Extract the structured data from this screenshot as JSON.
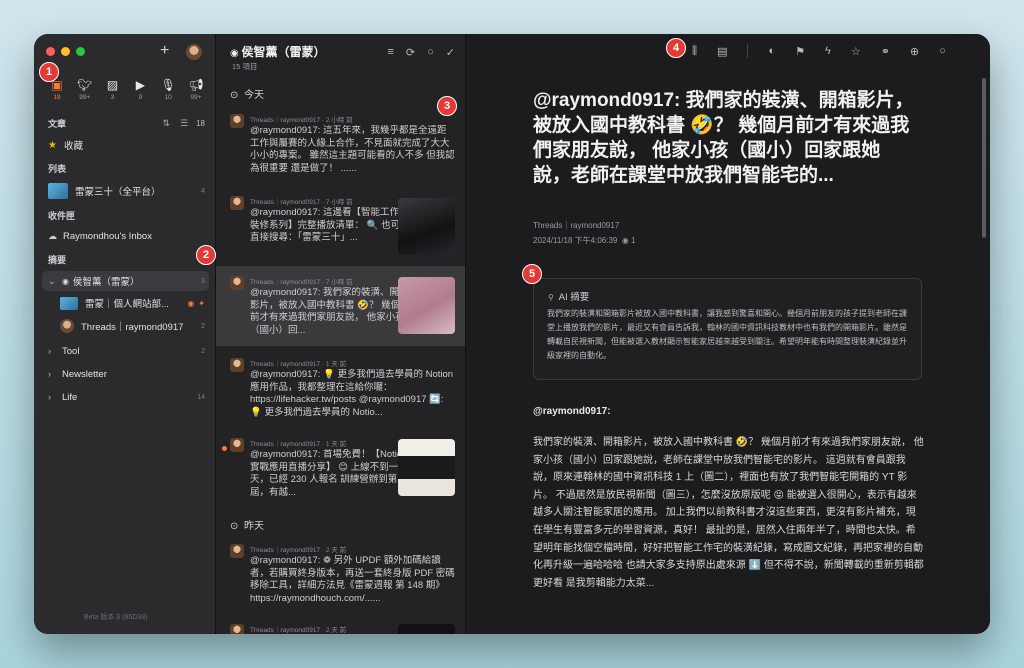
{
  "sidebar": {
    "sources": [
      {
        "icon": "folder-icon",
        "count": "19"
      },
      {
        "icon": "twitter-icon",
        "count": "99+"
      },
      {
        "icon": "image-icon",
        "count": "3"
      },
      {
        "icon": "youtube-icon",
        "count": "9"
      },
      {
        "icon": "podcast-icon",
        "count": "10"
      },
      {
        "icon": "megaphone-icon",
        "count": "99+"
      }
    ],
    "articles_label": "文章",
    "articles_count": "18",
    "starred": "收藏",
    "lists_label": "列表",
    "list_item": "雷蒙三十（全平台）",
    "list_item_count": "4",
    "inbox_label": "收件匣",
    "inbox_item": "Raymondhou's Inbox",
    "digest_label": "摘要",
    "groups": [
      {
        "label": "侯智薰（雷蒙）",
        "count": "3"
      },
      {
        "label": "雷蒙｜個人網站部...",
        "count": ""
      },
      {
        "label": "Threads｜raymond0917",
        "count": "2"
      },
      {
        "label": "Tool",
        "count": "2"
      },
      {
        "label": "Newsletter",
        "count": ""
      },
      {
        "label": "Life",
        "count": "14"
      }
    ],
    "footer": "Beta 版本 β (85D38)"
  },
  "list": {
    "title": "侯智薰（雷蒙）",
    "subtitle": "15 項目",
    "today": "今天",
    "yesterday": "昨天",
    "entries": [
      {
        "meta": "Threads｜raymond0917 · 2 小時 前",
        "text": "@raymond0917: 這五年來，我幾乎都是全遠距工作與屬賽的人緣上合作，不見面就完成了大大小小的專案。 雖然這主題可能看的人不多 但我認為很重要 還是做了！ ......"
      },
      {
        "meta": "Threads｜raymond0917 · 7 小時 前",
        "text": "@raymond0917: 這邊看【智能工作宅裝修系列】完整播放清單： 🔍 也可以直接搜尋：「雷蒙三十」..."
      },
      {
        "meta": "Threads｜raymond0917 · 7 小時 前",
        "text": "@raymond0917: 我們家的裝潢、開箱影片，被放入國中教科書 🤣？ 幾個月前才有來過我們家朋友說， 他家小孩（國小）回..."
      },
      {
        "meta": "Threads｜raymond0917 · 1 天 前",
        "text": "@raymond0917: 💡 更多我們過去學員的 Notion 應用作品，我都整理在這給你囉：https://lifehacker.tw/posts @raymond0917 🔄: 💡 更多我們過去學員的 Notio..."
      },
      {
        "meta": "Threads｜raymond0917 · 1 天 前",
        "text": "@raymond0917: 首場免費！【Notion 實戰應用直播分享】 😊 上線不到一天，已經 230 人報名 訓練營辦到第九屆，有越..."
      },
      {
        "meta": "Threads｜raymond0917 · 2 天 前",
        "text": "@raymond0917: ❁ 另外 UPDF 額外加碼給讀者，若購買終身版本，再送一套終身版 PDF 密碼移除工具，詳細方法見《雷蒙週報 第 148 期》 https://raymondhouch.com/......"
      },
      {
        "meta": "Threads｜raymond0917 · 2 天 前",
        "text": ""
      }
    ]
  },
  "reader": {
    "title": "@raymond0917: 我們家的裝潢、開箱影片，被放入國中教科書 🤣？ 幾個月前才有來過我們家朋友說， 他家小孩（國小）回家跟她說，老師在課堂中放我們智能宅的...",
    "source": "Threads｜raymond0917",
    "date": "2024/11/18 下午4:06:39",
    "views": "1",
    "ai_label": "AI 摘要",
    "ai_text": "我們家的裝潢和開箱影片被放入國中教科書，讓我感到驚喜和開心。幾個月前朋友的孩子提到老師在課堂上播放我們的影片，最近又有會員告訴我，翰林的國中資訊科技教材中也有我們的開箱影片。雖然是轉載自民視新聞，但能被選入教材顯示智能家居越來越受到關注。希望明年能有時間整理裝潢紀錄並升級家裡的自動化。",
    "author": "@raymond0917:",
    "body": "我們家的裝潢、開箱影片，被放入國中教科書 🤣？ 幾個月前才有來過我們家朋友說， 他家小孩（國小）回家跟她說，老師在課堂中放我們智能宅的影片。 這週就有會員跟我說，原來連翰林的國中資訊科技 1 上（圖二），裡面也有放了我們智能宅開箱的 YT 影片。 不過居然是放民視新聞（圖三），怎麼沒放原版呢 😝 能被選入很開心，表示有越來越多人關注智能家居的應用。 加上我們以前教科書才沒這些東西，更沒有影片補充，現在學生有豐富多元的學習資源，真好！ 最扯的是，居然入住兩年半了，時間也太快。希望明年能找個空檔時間，好好把智能工作宅的裝潢紀錄，寫成圖文紀錄，再把家裡的自動化再升級一遍哈哈哈 也請大家多支持原出處來源 ⬇️ 但不得不說，新聞轉載的重新剪輯都更好看 是我剪輯能力太菜..."
  },
  "markers": [
    "1",
    "2",
    "3",
    "4",
    "5"
  ],
  "colors": {
    "accent": "#ff7b2e",
    "marker": "#e53935",
    "window_bg": "#1b1b1d"
  }
}
